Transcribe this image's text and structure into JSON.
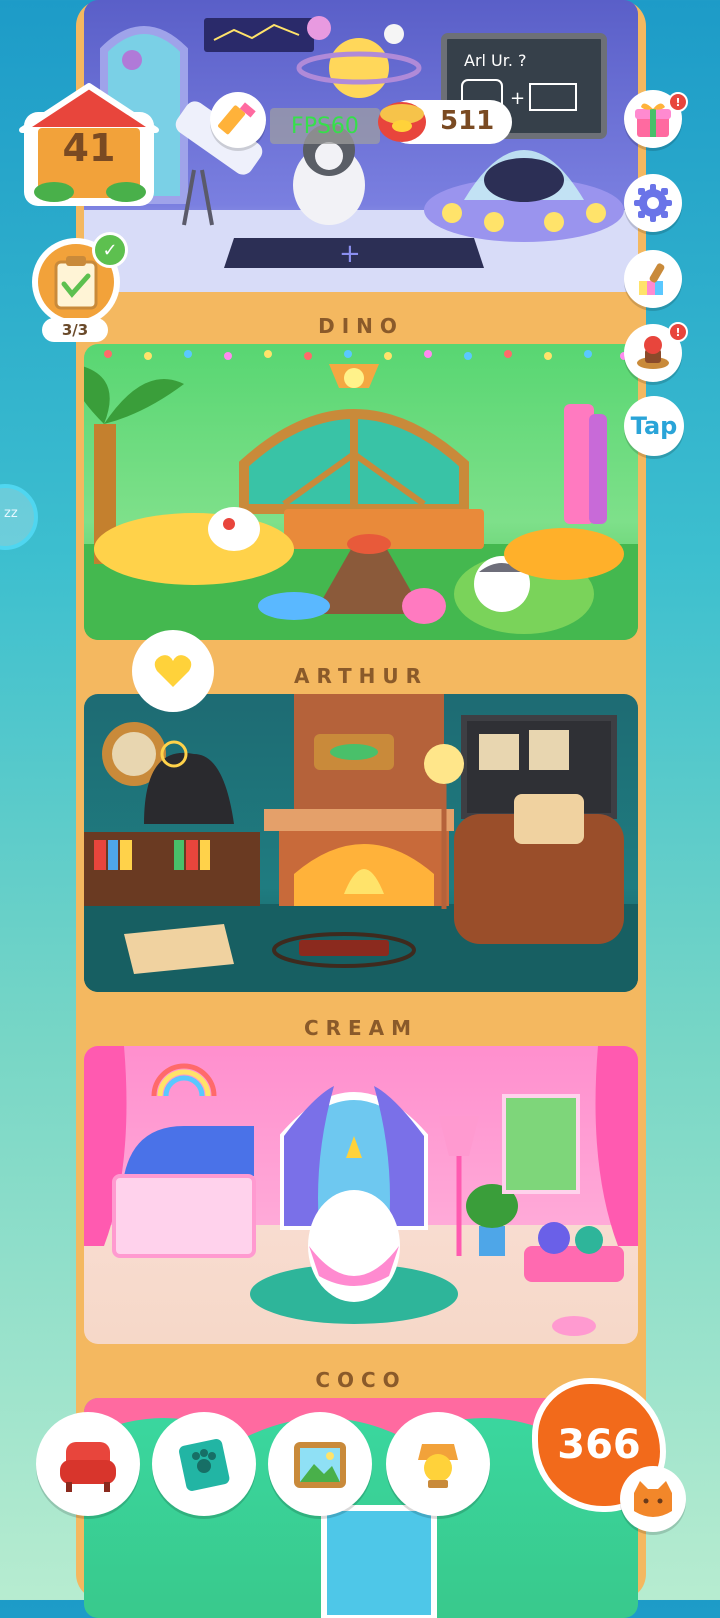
{
  "hud": {
    "house_level": "41",
    "fps": "FPS60",
    "cans": "511",
    "tasks_progress": "3/3",
    "tap_label": "Tap",
    "hearts_count": "366"
  },
  "rooms": [
    {
      "name": "DINO"
    },
    {
      "name": "ARTHUR"
    },
    {
      "name": "CREAM"
    },
    {
      "name": "COCO"
    }
  ],
  "space_room": {
    "chalkboard_text": "´¿×⁄ ?"
  },
  "icons": {
    "house": "house-icon",
    "pencil": "pencil-icon",
    "can": "cat-food-can-icon",
    "gift": "gift-icon",
    "gear": "gear-icon",
    "brush": "paint-roller-icon",
    "stamp": "stamp-icon",
    "task": "clipboard-check-icon",
    "armchair": "armchair-icon",
    "book": "paw-book-icon",
    "frame": "picture-frame-icon",
    "lamp": "lamp-icon",
    "cat": "cat-face-icon",
    "sleep": "sleep-icon"
  },
  "colors": {
    "tower": "#f4b860",
    "label_text": "#8a5a2a",
    "orange_accent": "#f26a1b",
    "notification": "#e8453c",
    "check_green": "#5dc04f"
  }
}
